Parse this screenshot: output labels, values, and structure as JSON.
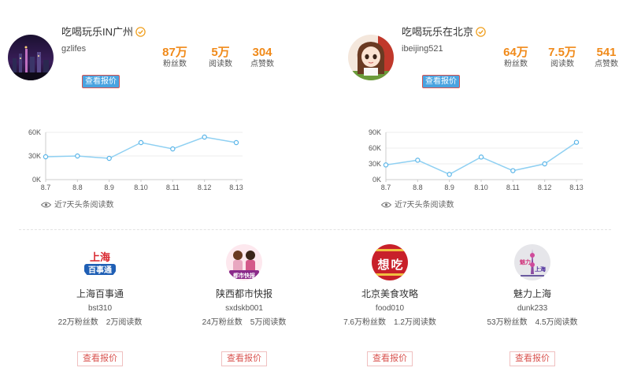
{
  "profiles": [
    {
      "name": "吃喝玩乐IN广州",
      "handle": "gzlifes",
      "stats": [
        {
          "value": "87万",
          "label": "粉丝数"
        },
        {
          "value": "5万",
          "label": "阅读数"
        },
        {
          "value": "304",
          "label": "点赞数"
        }
      ],
      "quote_label": "查看报价",
      "chart_footer": "近7天头条阅读数",
      "icons": {
        "verified": "verified-badge-icon",
        "eye": "eye-icon"
      }
    },
    {
      "name": "吃喝玩乐在北京",
      "handle": "ibeijing521",
      "stats": [
        {
          "value": "64万",
          "label": "粉丝数"
        },
        {
          "value": "7.5万",
          "label": "阅读数"
        },
        {
          "value": "541",
          "label": "点赞数"
        }
      ],
      "quote_label": "查看报价",
      "chart_footer": "近7天头条阅读数",
      "icons": {
        "verified": "verified-badge-icon",
        "eye": "eye-icon"
      }
    }
  ],
  "chart_data": [
    {
      "type": "line",
      "x": [
        "8.7",
        "8.8",
        "8.9",
        "8.10",
        "8.11",
        "8.12",
        "8.13"
      ],
      "series": [
        {
          "values": [
            29000,
            30000,
            27000,
            47000,
            39000,
            54000,
            47000
          ]
        }
      ],
      "yticks": [
        "0K",
        "30K",
        "60K"
      ],
      "ylim": [
        0,
        60000
      ],
      "grid": true,
      "color": "#8fd0f2"
    },
    {
      "type": "line",
      "x": [
        "8.7",
        "8.8",
        "8.9",
        "8.10",
        "8.11",
        "8.12",
        "8.13"
      ],
      "series": [
        {
          "values": [
            28000,
            37000,
            10000,
            43000,
            17000,
            30000,
            71000
          ]
        }
      ],
      "yticks": [
        "0K",
        "30K",
        "60K",
        "90K"
      ],
      "ylim": [
        0,
        90000
      ],
      "grid": true,
      "color": "#8fd0f2"
    }
  ],
  "accounts": [
    {
      "name": "上海百事通",
      "handle": "bst310",
      "fans": "22万粉丝数",
      "reads": "2万阅读数",
      "quote_label": "查看报价"
    },
    {
      "name": "陕西都市快报",
      "handle": "sxdskb001",
      "fans": "24万粉丝数",
      "reads": "5万阅读数",
      "quote_label": "查看报价"
    },
    {
      "name": "北京美食攻略",
      "handle": "food010",
      "fans": "7.6万粉丝数",
      "reads": "1.2万阅读数",
      "quote_label": "查看报价"
    },
    {
      "name": "魅力上海",
      "handle": "dunk233",
      "fans": "53万粉丝数",
      "reads": "4.5万阅读数",
      "quote_label": "查看报价"
    }
  ],
  "logo_text": {
    "shanghai_baishitong": [
      "上海",
      "百事通"
    ],
    "shaanxi_dushi": "都市快报",
    "beijing_meishi": [
      "想",
      "吃"
    ],
    "meili_shanghai": [
      "魅力",
      "上海"
    ]
  },
  "colors": {
    "accent": "#f08a1a",
    "line": "#8fd0f2",
    "blue_button": "#4aa3e0",
    "red": "#d9534f"
  }
}
